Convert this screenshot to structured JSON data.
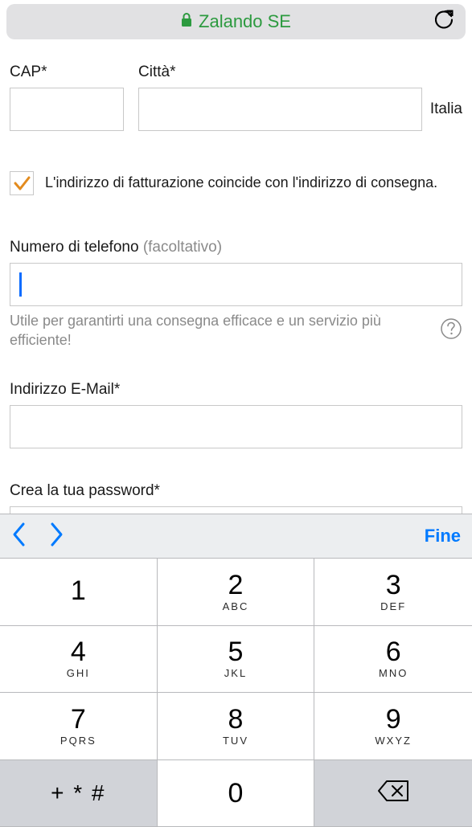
{
  "addressBar": {
    "siteName": "Zalando SE"
  },
  "form": {
    "cap": {
      "label": "CAP*",
      "value": ""
    },
    "city": {
      "label": "Città*",
      "value": ""
    },
    "country": "Italia",
    "billingCheckbox": {
      "label": "L'indirizzo di fatturazione coincide con l'indirizzo di consegna.",
      "checked": true
    },
    "phone": {
      "labelMain": "Numero di telefono ",
      "labelOptional": "(facoltativo)",
      "value": "",
      "helpText": "Utile per garantirti una consegna efficace e un servizio più efficiente!"
    },
    "email": {
      "label": "Indirizzo E-Mail*",
      "value": ""
    },
    "password": {
      "label": "Crea la tua password*",
      "value": ""
    }
  },
  "keyboard": {
    "doneLabel": "Fine",
    "keys": [
      {
        "digit": "1",
        "letters": ""
      },
      {
        "digit": "2",
        "letters": "ABC"
      },
      {
        "digit": "3",
        "letters": "DEF"
      },
      {
        "digit": "4",
        "letters": "GHI"
      },
      {
        "digit": "5",
        "letters": "JKL"
      },
      {
        "digit": "6",
        "letters": "MNO"
      },
      {
        "digit": "7",
        "letters": "PQRS"
      },
      {
        "digit": "8",
        "letters": "TUV"
      },
      {
        "digit": "9",
        "letters": "WXYZ"
      }
    ],
    "symbolsKey": "+ * #",
    "zeroKey": "0"
  }
}
